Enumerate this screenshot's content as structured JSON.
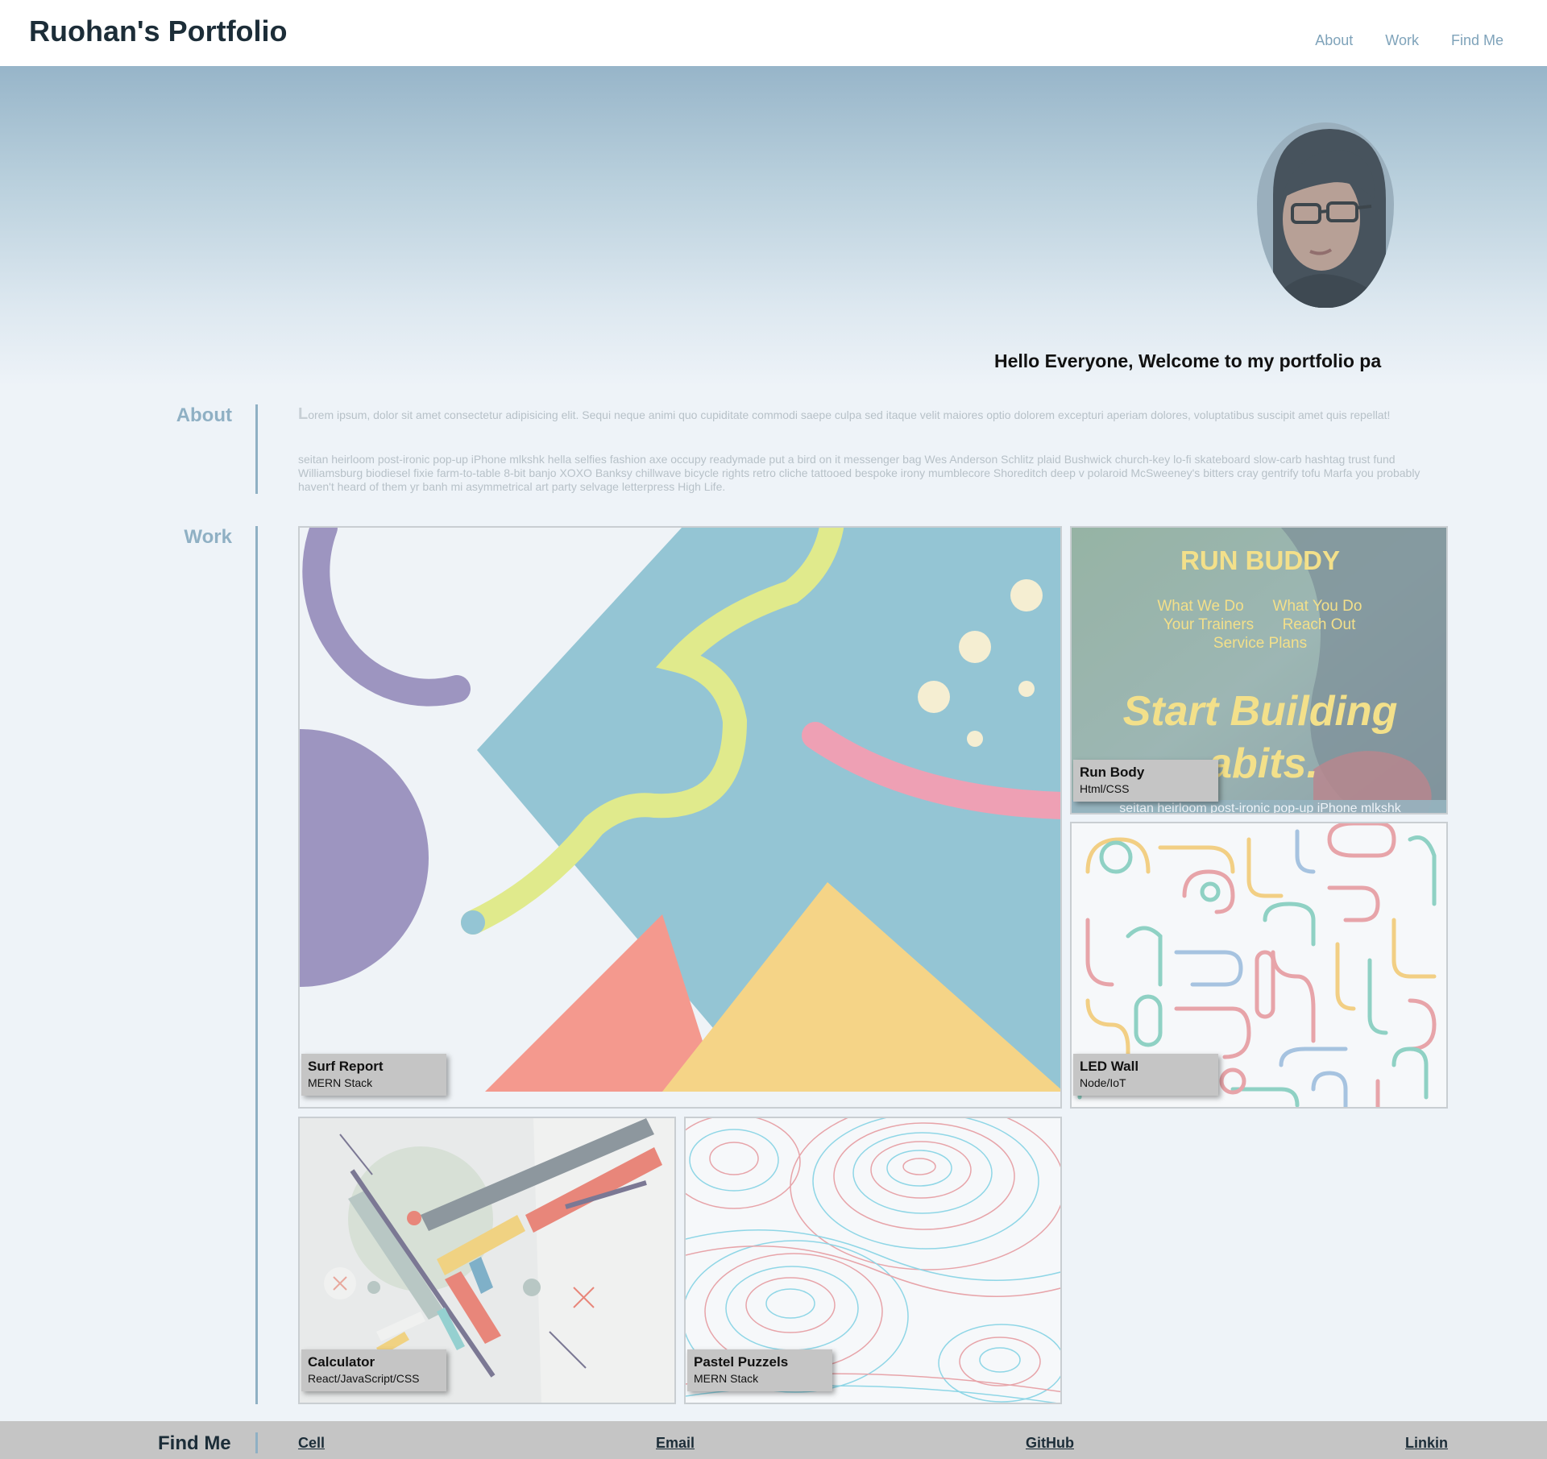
{
  "header": {
    "title": "Ruohan's Portfolio",
    "nav": [
      "About",
      "Work",
      "Find Me"
    ]
  },
  "hero": {
    "greeting": "Hello Everyone, Welcome to my portfolio pa"
  },
  "about": {
    "label": "About",
    "dropcap": "L",
    "paragraph1": "orem ipsum, dolor sit amet consectetur adipisicing elit. Sequi neque animi quo cupiditate commodi saepe culpa sed itaque velit maiores optio dolorem excepturi aperiam dolores, voluptatibus suscipit amet quis repellat!",
    "paragraph2": "seitan heirloom post-ironic pop-up iPhone mlkshk hella selfies fashion axe occupy readymade put a bird on it messenger bag Wes Anderson Schlitz plaid Bushwick church-key lo-fi skateboard slow-carb hashtag trust fund Williamsburg biodiesel fixie farm-to-table 8-bit banjo XOXO Banksy chillwave bicycle rights retro cliche tattooed bespoke irony mumblecore Shoreditch deep v polaroid McSweeney's bitters cray gentrify tofu Marfa you probably haven't heard of them yr banh mi asymmetrical art party selvage letterpress High Life."
  },
  "work": {
    "label": "Work",
    "projects": [
      {
        "title": "Surf Report",
        "stack": "MERN Stack"
      },
      {
        "title": "Run Body",
        "stack": "Html/CSS"
      },
      {
        "title": "LED Wall",
        "stack": "Node/IoT"
      },
      {
        "title": "Calculator",
        "stack": "React/JavaScript/CSS"
      },
      {
        "title": "Pastel Puzzels",
        "stack": "MERN Stack"
      }
    ],
    "runbuddy": {
      "title": "RUN BUDDY",
      "menu": [
        "What We Do",
        "What You Do",
        "Your Trainers",
        "Reach Out",
        "Service Plans"
      ],
      "headline1": "Start Building",
      "headline2": "abits.",
      "footer_text": "seitan heirloom post-ironic pop-up iPhone mlkshk"
    }
  },
  "footer": {
    "title": "Find Me",
    "links": [
      "Cell",
      "Email",
      "GitHub",
      "Linkin"
    ]
  },
  "colors": {
    "accent": "#8fb0c4",
    "title_dark": "#1c2d38",
    "footer_bg": "#c5c5c5"
  }
}
